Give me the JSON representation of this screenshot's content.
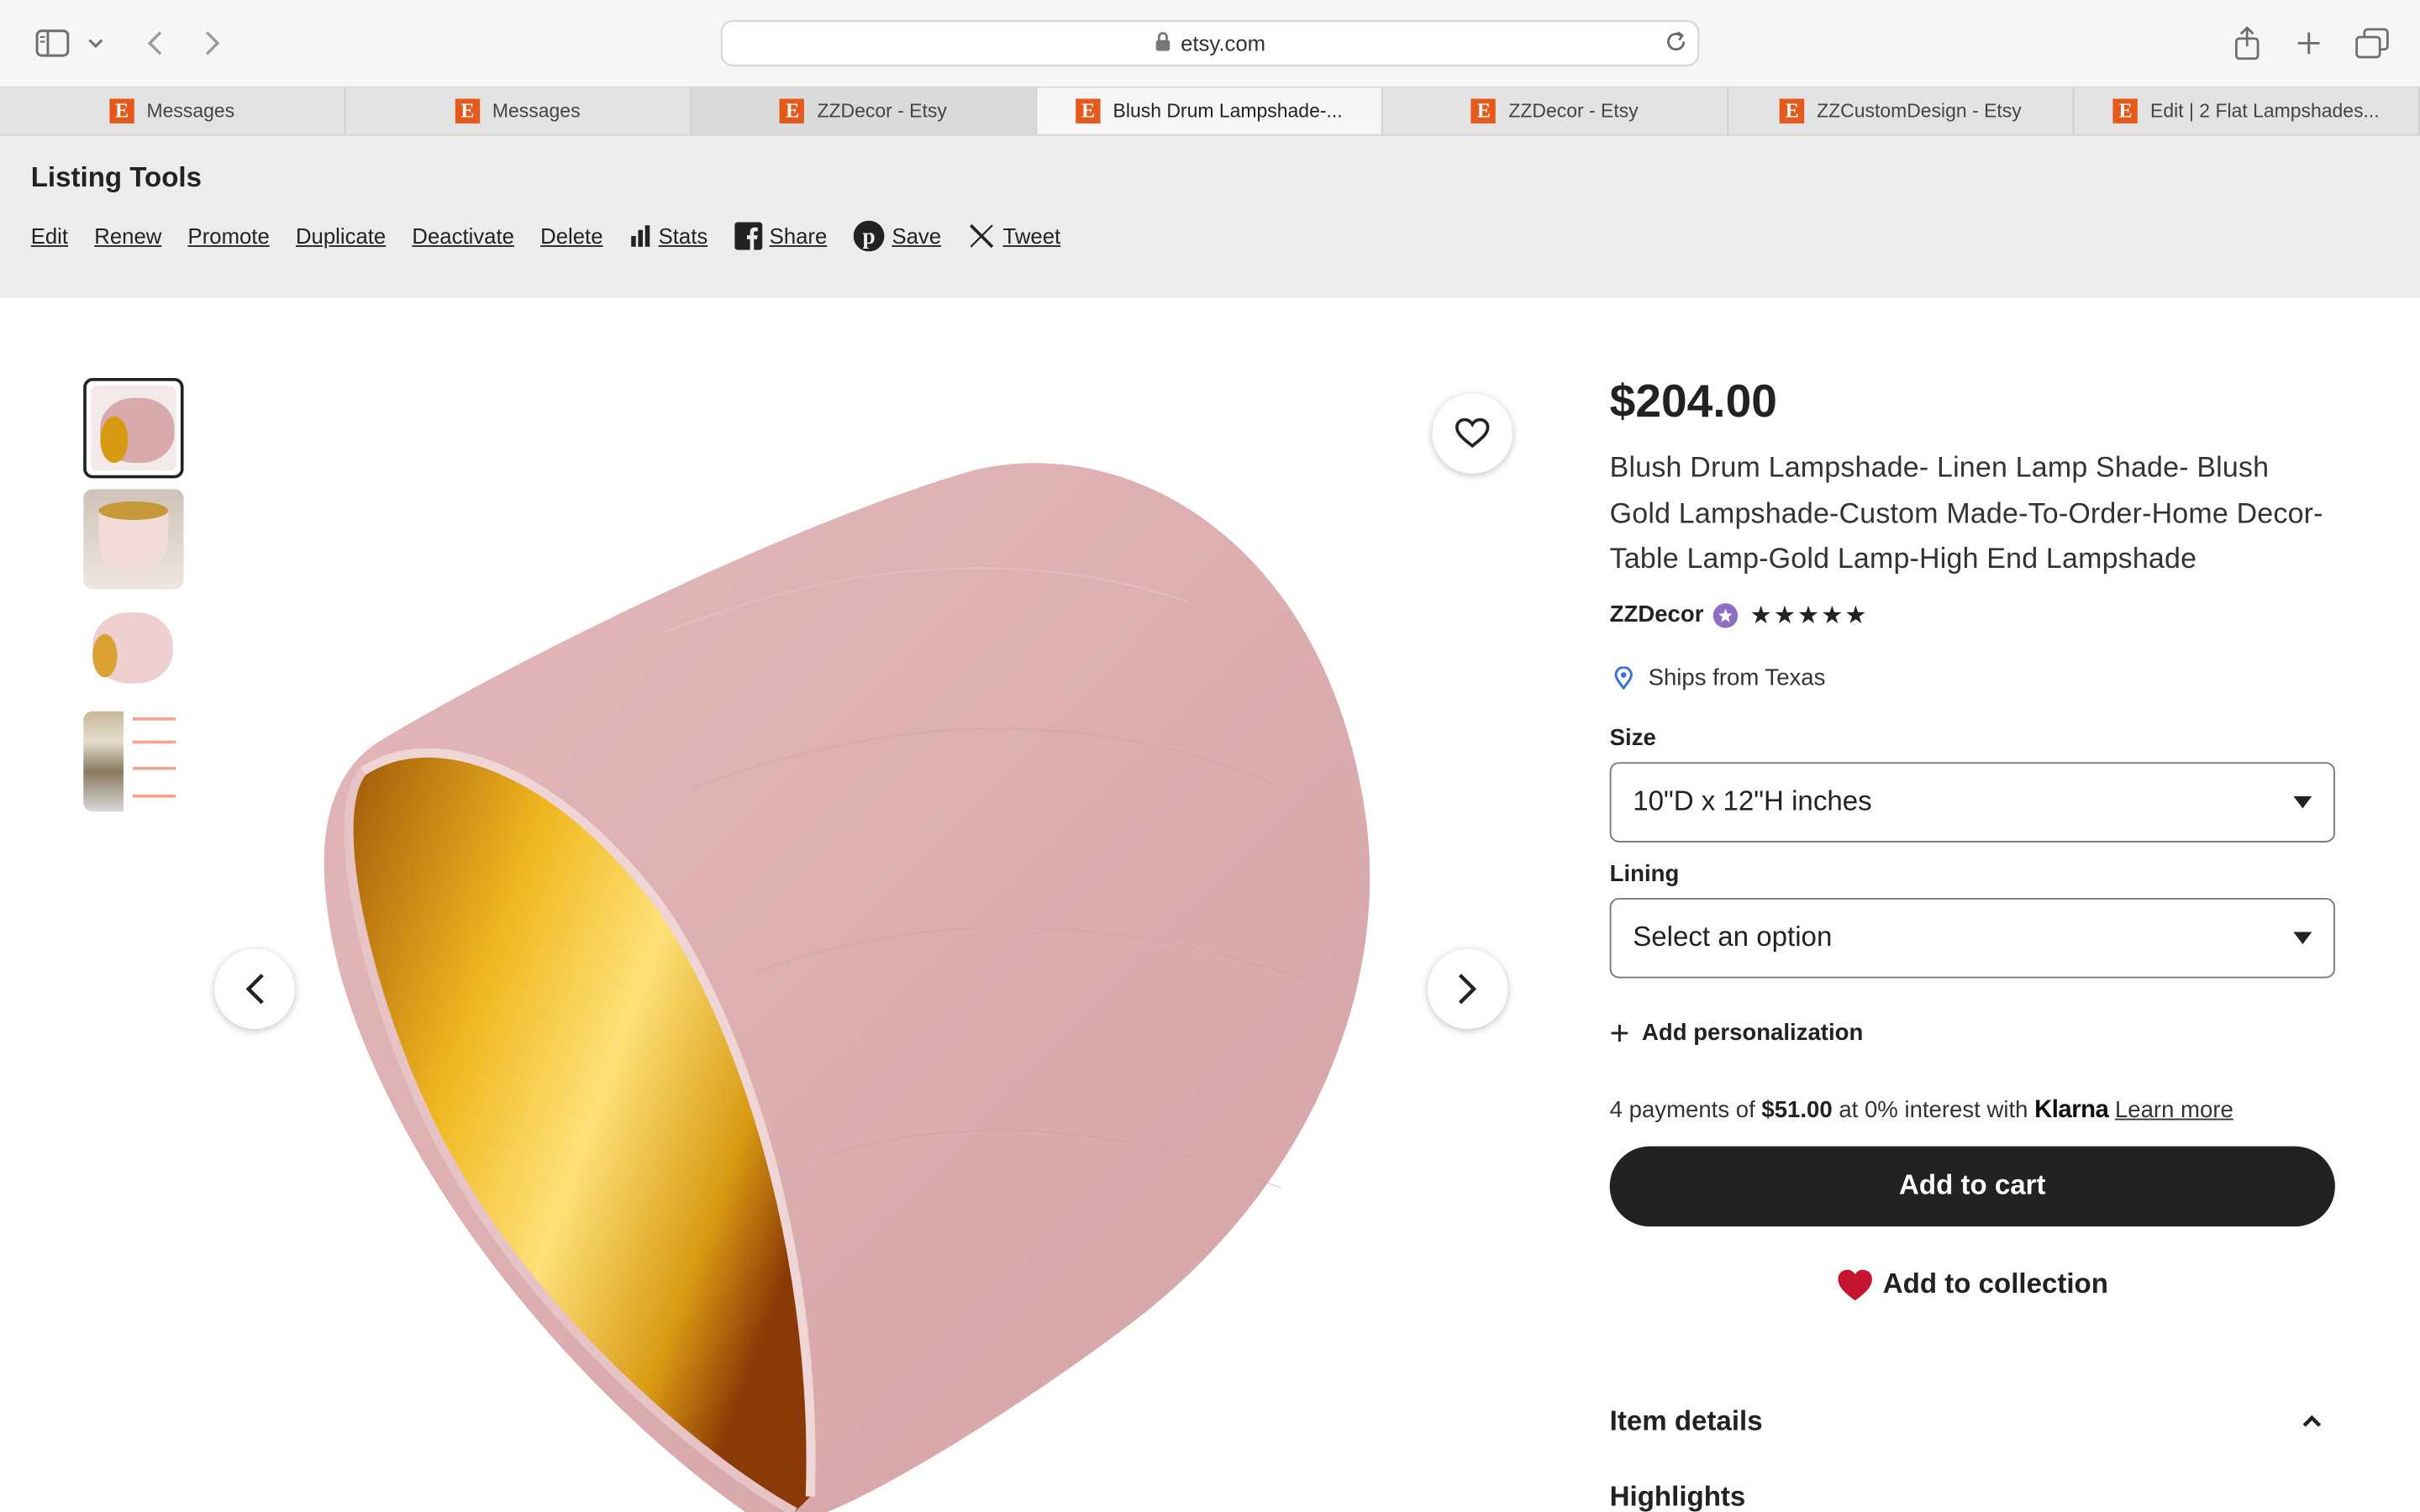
{
  "browser": {
    "url": "etsy.com",
    "tabs": [
      {
        "label": "Messages"
      },
      {
        "label": "Messages"
      },
      {
        "label": "ZZDecor - Etsy"
      },
      {
        "label": "Blush Drum Lampshade-..."
      },
      {
        "label": "ZZDecor - Etsy"
      },
      {
        "label": "ZZCustomDesign - Etsy"
      },
      {
        "label": "Edit | 2 Flat Lampshades..."
      }
    ],
    "favicon_letter": "E"
  },
  "tools": {
    "title": "Listing Tools",
    "links": {
      "edit": "Edit",
      "renew": "Renew",
      "promote": "Promote",
      "duplicate": "Duplicate",
      "deactivate": "Deactivate",
      "delete": "Delete",
      "stats": "Stats",
      "share": "Share",
      "save": "Save",
      "tweet": "Tweet"
    }
  },
  "product": {
    "price": "$204.00",
    "title": "Blush Drum Lampshade- Linen Lamp Shade- Blush Gold Lampshade-Custom Made-To-Order-Home Decor-Table Lamp-Gold Lamp-High End Lampshade",
    "shop": "ZZDecor",
    "rating": 5,
    "ships_from": "Ships from Texas",
    "size_label": "Size",
    "size_value": "10\"D x 12\"H inches",
    "lining_label": "Lining",
    "lining_value": "Select an option",
    "add_personalization": "Add personalization",
    "klarna": {
      "prefix": "4 payments of",
      "amount": "$51.00",
      "middle": "at 0% interest with",
      "brand": "Klarna",
      "learn_more": "Learn more"
    },
    "add_to_cart": "Add to cart",
    "add_to_collection": "Add to collection",
    "item_details": "Item details",
    "highlights": "Highlights"
  },
  "colors": {
    "shade": "#dcaeb0",
    "gold": "#d89a12",
    "etsy_orange": "#e35a1c",
    "heart_red": "#c4142f",
    "button_dark": "#222222"
  }
}
